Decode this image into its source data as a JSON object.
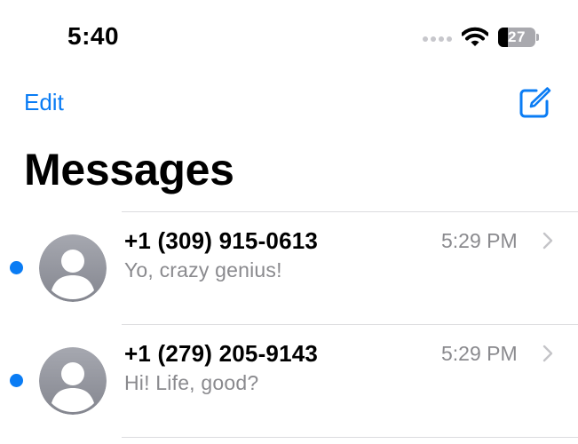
{
  "status_bar": {
    "time": "5:40",
    "battery_level": "27",
    "battery_fraction": 0.27
  },
  "nav": {
    "edit_label": "Edit",
    "compose_icon": "compose-icon"
  },
  "title": "Messages",
  "colors": {
    "accent": "#0a7cf4",
    "secondary_text": "#8a8a8e",
    "divider": "#dcdcdf"
  },
  "conversations": [
    {
      "sender": "+1 (309) 915-0613",
      "time": "5:29 PM",
      "preview": "Yo, crazy genius!",
      "unread": true
    },
    {
      "sender": "+1 (279) 205-9143",
      "time": "5:29 PM",
      "preview": "Hi! Life, good?",
      "unread": true
    }
  ]
}
